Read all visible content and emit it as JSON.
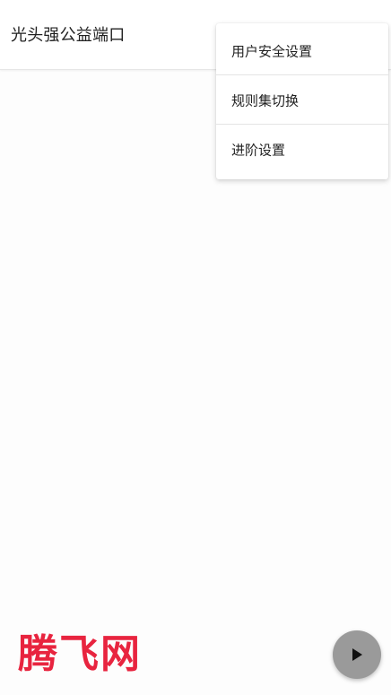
{
  "app_bar": {
    "title": "光头强公益端口"
  },
  "overflow_menu": {
    "items": [
      {
        "label": "用户安全设置"
      },
      {
        "label": "规则集切换"
      },
      {
        "label": "进阶设置"
      }
    ]
  },
  "watermark": {
    "text": "腾飞网",
    "color": "#e8243f"
  },
  "fab": {
    "icon": "play-icon",
    "color": "#9a9a9a"
  }
}
